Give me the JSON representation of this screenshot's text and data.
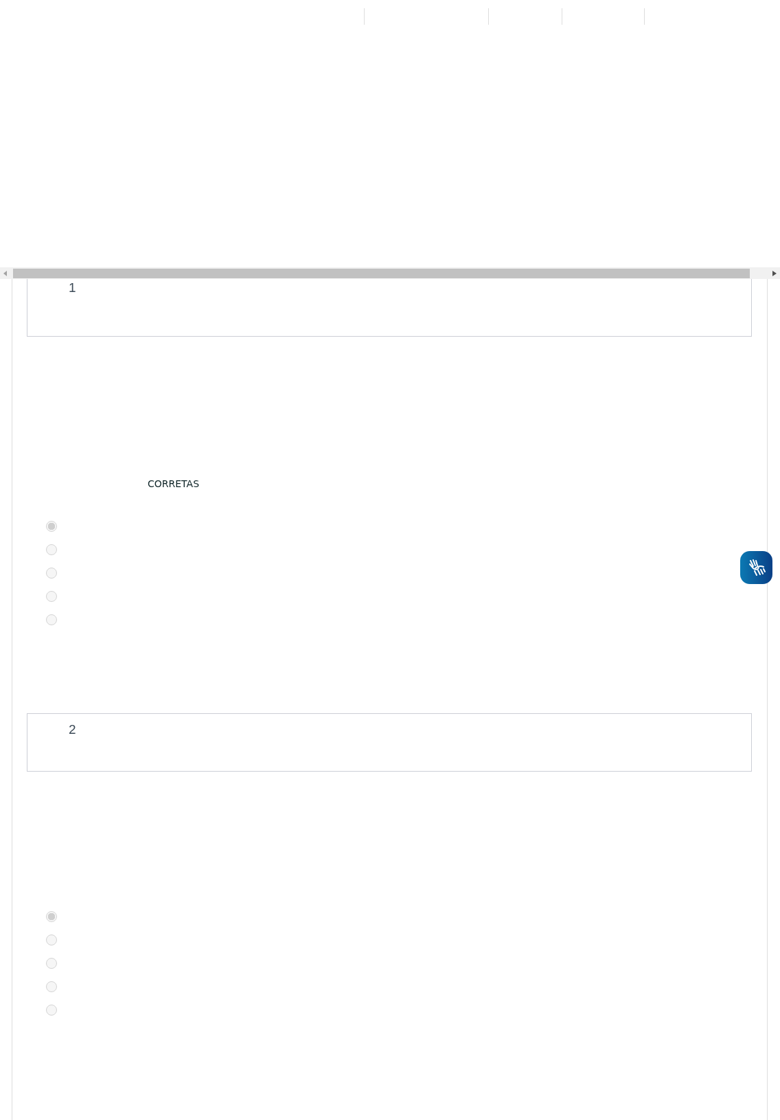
{
  "questions": [
    {
      "number": "1",
      "note": "CORRETAS",
      "options": [
        {
          "selected": true
        },
        {
          "selected": false
        },
        {
          "selected": false
        },
        {
          "selected": false
        },
        {
          "selected": false
        }
      ]
    },
    {
      "number": "2",
      "options": [
        {
          "selected": true
        },
        {
          "selected": false
        },
        {
          "selected": false
        },
        {
          "selected": false
        },
        {
          "selected": false
        }
      ]
    }
  ]
}
